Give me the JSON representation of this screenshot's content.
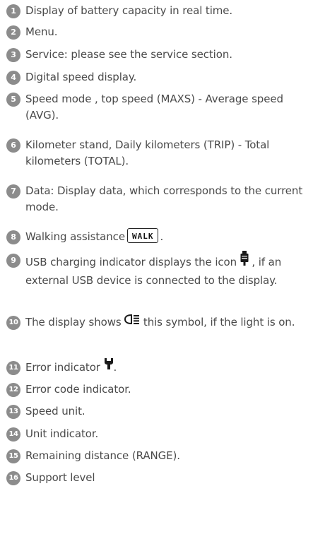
{
  "items": [
    {
      "num": "1",
      "text": "Display of battery capacity in real time."
    },
    {
      "num": "2",
      "text": "Menu."
    },
    {
      "num": "3",
      "text": "Service: please see the service section."
    },
    {
      "num": "4",
      "text": "Digital speed display."
    },
    {
      "num": "5",
      "text": "Speed mode , top speed (MAXS) - Average speed (AVG)."
    },
    {
      "num": "6",
      "text": "Kilometer stand, Daily kilometers (TRIP) - Total kilometers (TOTAL)."
    },
    {
      "num": "7",
      "text": "Data: Display data, which corresponds to the current mode."
    },
    {
      "num": "8",
      "text_before": "Walking assistance",
      "badge": "WALK",
      "text_after": "."
    },
    {
      "num": "9",
      "text_before": "USB charging indicator displays the icon",
      "text_after": ", if an external USB device is connected to the display.",
      "icon": "usb-charging-icon"
    },
    {
      "num": "10",
      "text_before": "The display shows",
      "text_after": "this symbol, if the light is on.",
      "icon": "headlight-icon"
    },
    {
      "num": "11",
      "text_before": "Error indicator",
      "text_after": ".",
      "icon": "wrench-icon"
    },
    {
      "num": "12",
      "text": "Error code indicator."
    },
    {
      "num": "13",
      "text": "Speed unit."
    },
    {
      "num": "14",
      "text": "Unit indicator."
    },
    {
      "num": "15",
      "text": "Remaining distance (RANGE)."
    },
    {
      "num": "16",
      "text": "Support level"
    }
  ],
  "colors": {
    "badge_bg": "#8c8c8c",
    "text": "#4a4a4a"
  }
}
